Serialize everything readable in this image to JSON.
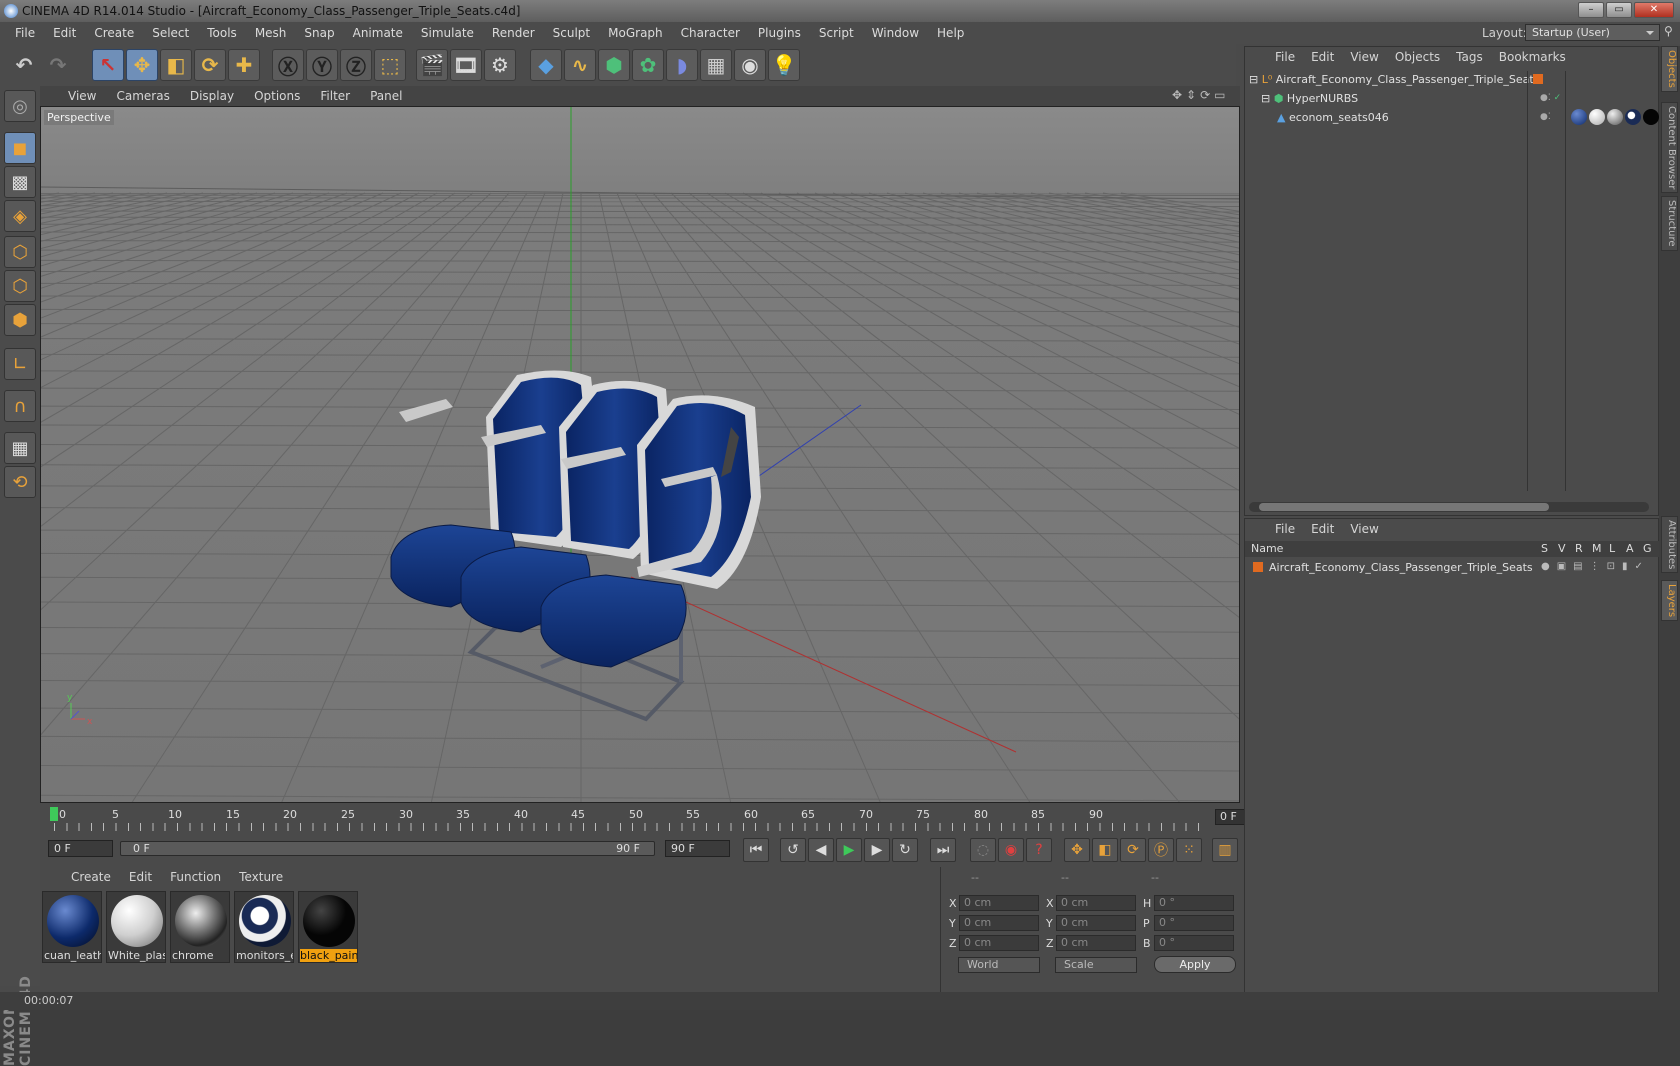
{
  "window": {
    "title": "CINEMA 4D R14.014 Studio - [Aircraft_Economy_Class_Passenger_Triple_Seats.c4d]"
  },
  "menubar": [
    "File",
    "Edit",
    "Create",
    "Select",
    "Tools",
    "Mesh",
    "Snap",
    "Animate",
    "Simulate",
    "Render",
    "Sculpt",
    "MoGraph",
    "Character",
    "Plugins",
    "Script",
    "Window",
    "Help"
  ],
  "layout": {
    "label": "Layout:",
    "value": "Startup (User)"
  },
  "viewport": {
    "menu": [
      "View",
      "Cameras",
      "Display",
      "Options",
      "Filter",
      "Panel"
    ],
    "camera_label": "Perspective"
  },
  "timeline": {
    "ticks": [
      "0",
      "5",
      "10",
      "15",
      "20",
      "25",
      "30",
      "35",
      "40",
      "45",
      "50",
      "55",
      "60",
      "65",
      "70",
      "75",
      "80",
      "85",
      "90"
    ],
    "current_frame": "0 F",
    "start_frame": "0 F",
    "range_start": "0 F",
    "range_end": "90 F",
    "end_frame": "90 F"
  },
  "materials": {
    "menu": [
      "Create",
      "Edit",
      "Function",
      "Texture"
    ],
    "items": [
      {
        "name": "cuan_leath",
        "color": "#0d2a6b"
      },
      {
        "name": "White_plas",
        "color": "#e6e6e6"
      },
      {
        "name": "chrome",
        "color": "#777777"
      },
      {
        "name": "monitors_e",
        "color": "#1a2b55"
      },
      {
        "name": "black_pain",
        "color": "#050505"
      }
    ]
  },
  "coords": {
    "headers": [
      "--",
      "--",
      "--"
    ],
    "rows": [
      {
        "a": "X",
        "av": "0 cm",
        "b": "X",
        "bv": "0 cm",
        "c": "H",
        "cv": "0 °"
      },
      {
        "a": "Y",
        "av": "0 cm",
        "b": "Y",
        "bv": "0 cm",
        "c": "P",
        "cv": "0 °"
      },
      {
        "a": "Z",
        "av": "0 cm",
        "b": "Z",
        "bv": "0 cm",
        "c": "B",
        "cv": "0 °"
      }
    ],
    "mode1": "World",
    "mode2": "Scale",
    "apply": "Apply"
  },
  "object_manager": {
    "menu": [
      "File",
      "Edit",
      "View",
      "Objects",
      "Tags",
      "Bookmarks"
    ],
    "objects": [
      {
        "name": "Aircraft_Economy_Class_Passenger_Triple_Seats"
      },
      {
        "name": "HyperNURBS"
      },
      {
        "name": "econom_seats046"
      }
    ]
  },
  "layer_manager": {
    "menu": [
      "File",
      "Edit",
      "View"
    ],
    "columns": [
      "Name",
      "S",
      "V",
      "R",
      "M",
      "L",
      "A",
      "G"
    ],
    "layers": [
      {
        "name": "Aircraft_Economy_Class_Passenger_Triple_Seats",
        "color": "#e06a20"
      }
    ]
  },
  "side_tabs": [
    "Objects",
    "Content Browser",
    "Structure",
    "Attributes",
    "Layers"
  ],
  "status": {
    "time": "00:00:07"
  },
  "colors": {
    "accent": "#f0a010",
    "seat_blue": "#0b2a6e",
    "grid": "#5a5a5a"
  }
}
